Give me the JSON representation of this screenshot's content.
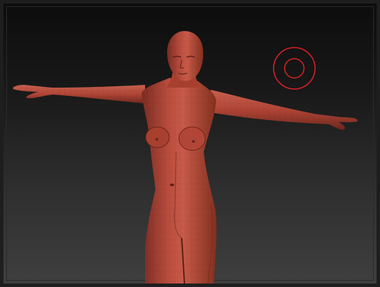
{
  "viewport": {
    "background_top": "#0d0d0d",
    "background_bottom": "#3f3f3f",
    "model_color": "#b44a3c",
    "model_shadow": "#6e2820",
    "model_highlight": "#d98070",
    "cursor_color": "#e0202a"
  },
  "model": {
    "name_icon": "female-base-mesh",
    "pose": "T-pose"
  },
  "brush": {
    "icon": "brush-cursor-circle"
  }
}
